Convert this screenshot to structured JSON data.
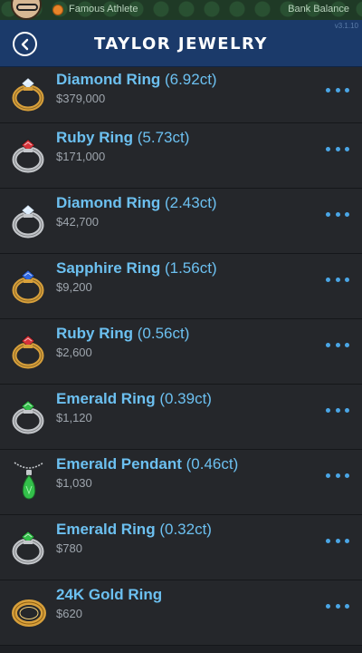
{
  "status_bar": {
    "occupation": "Famous Athlete",
    "balance_label": "Bank Balance"
  },
  "header": {
    "title": "TAYLOR JEWELRY",
    "version": "v3.1.10"
  },
  "items": [
    {
      "name": "Diamond Ring",
      "carat": "(6.92ct)",
      "price": "$379,000",
      "icon": "diamond-ring",
      "band": "#d8a03b",
      "gem": "#ddeeff"
    },
    {
      "name": "Ruby Ring",
      "carat": "(5.73ct)",
      "price": "$171,000",
      "icon": "ruby-ring",
      "band": "#c4c7cb",
      "gem": "#d8333a"
    },
    {
      "name": "Diamond Ring",
      "carat": "(2.43ct)",
      "price": "$42,700",
      "icon": "diamond-ring",
      "band": "#c4c7cb",
      "gem": "#ddeeff"
    },
    {
      "name": "Sapphire Ring",
      "carat": "(1.56ct)",
      "price": "$9,200",
      "icon": "sapphire-ring",
      "band": "#d8a03b",
      "gem": "#2f67e0"
    },
    {
      "name": "Ruby Ring",
      "carat": "(0.56ct)",
      "price": "$2,600",
      "icon": "ruby-ring",
      "band": "#d8a03b",
      "gem": "#d8333a"
    },
    {
      "name": "Emerald Ring",
      "carat": "(0.39ct)",
      "price": "$1,120",
      "icon": "emerald-ring",
      "band": "#c4c7cb",
      "gem": "#33c04a"
    },
    {
      "name": "Emerald Pendant",
      "carat": "(0.46ct)",
      "price": "$1,030",
      "icon": "emerald-pendant",
      "band": "#c4c7cb",
      "gem": "#33c04a"
    },
    {
      "name": "Emerald Ring",
      "carat": "(0.32ct)",
      "price": "$780",
      "icon": "emerald-ring",
      "band": "#c4c7cb",
      "gem": "#33c04a"
    },
    {
      "name": "24K Gold Ring",
      "carat": "",
      "price": "$620",
      "icon": "gold-band-ring",
      "band": "#d8a03b",
      "gem": ""
    }
  ]
}
